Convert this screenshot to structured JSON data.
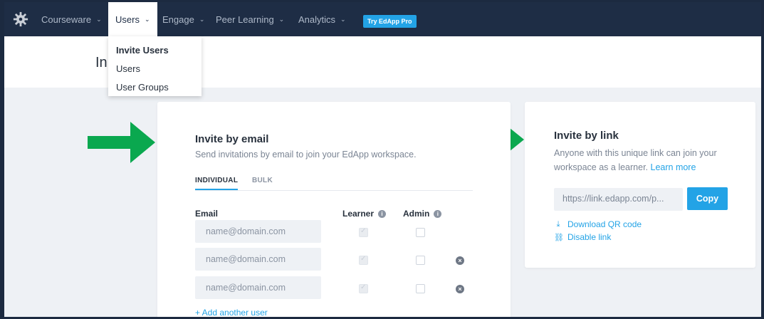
{
  "nav": {
    "items": [
      {
        "label": "Courseware"
      },
      {
        "label": "Users"
      },
      {
        "label": "Engage"
      },
      {
        "label": "Peer Learning"
      },
      {
        "label": "Analytics"
      }
    ],
    "pro_button": "Try EdApp Pro"
  },
  "page": {
    "title": "In"
  },
  "dropdown": {
    "items": [
      {
        "label": "Invite Users"
      },
      {
        "label": "Users"
      },
      {
        "label": "User Groups"
      }
    ]
  },
  "invite_email": {
    "title": "Invite by email",
    "description": "Send invitations by email to join your EdApp workspace.",
    "tabs": [
      {
        "label": "INDIVIDUAL"
      },
      {
        "label": "BULK"
      }
    ],
    "columns": {
      "email": "Email",
      "learner": "Learner",
      "admin": "Admin"
    },
    "rows": [
      {
        "placeholder": "name@domain.com",
        "learner": true,
        "admin": false
      },
      {
        "placeholder": "name@domain.com",
        "learner": true,
        "admin": false
      },
      {
        "placeholder": "name@domain.com",
        "learner": true,
        "admin": false
      }
    ],
    "add_user": "+ Add another user"
  },
  "invite_link": {
    "title": "Invite by link",
    "description": "Anyone with this unique link can join your workspace as a learner.",
    "learn_more": "Learn more",
    "link_value": "https://link.edapp.com/p...",
    "copy_label": "Copy",
    "download_qr": "Download QR code",
    "disable_link": "Disable link"
  },
  "colors": {
    "nav_bg": "#1e2d45",
    "accent": "#23a3e6",
    "arrow": "#0aa84f"
  }
}
